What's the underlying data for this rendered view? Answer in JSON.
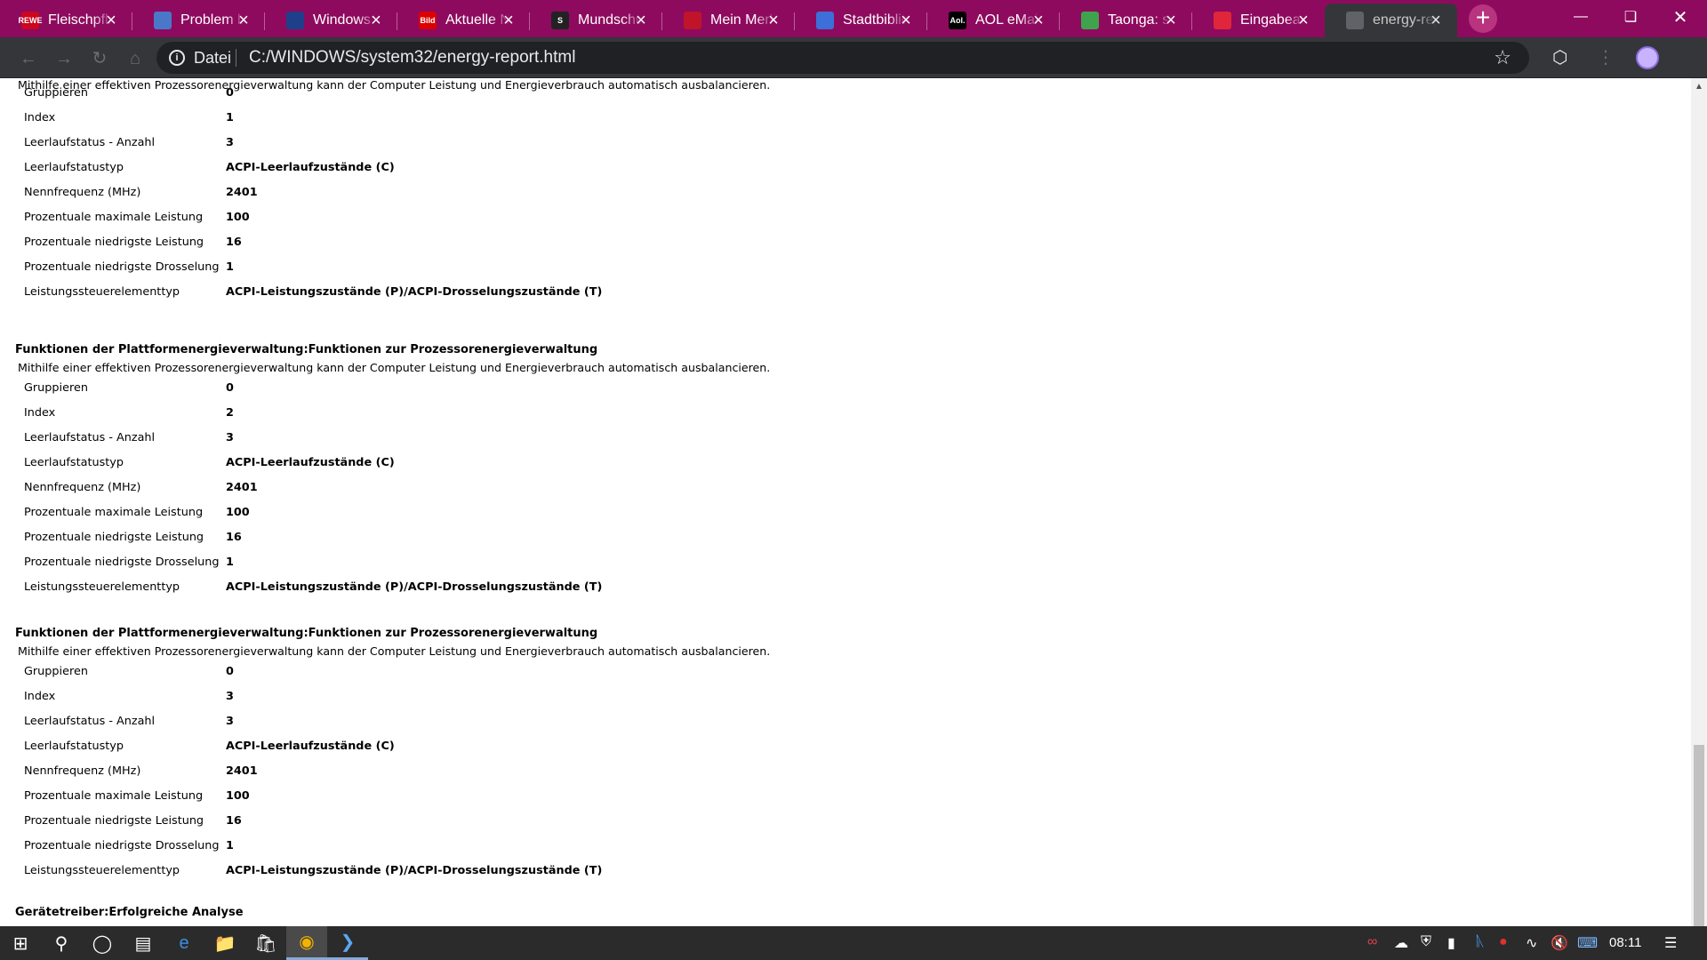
{
  "browser": {
    "tabs": [
      {
        "title": "Fleischpfla",
        "favicon": "rewe-icon",
        "fav_color": "#cc071e",
        "fav_text": "REWE"
      },
      {
        "title": "Problem b",
        "favicon": "globe-icon",
        "fav_color": "#4a78c8",
        "fav_text": ""
      },
      {
        "title": "Windows:",
        "favicon": "windows-central-icon",
        "fav_color": "#1f3f8a",
        "fav_text": ""
      },
      {
        "title": "Aktuelle N",
        "favicon": "bild-icon",
        "fav_color": "#dd0000",
        "fav_text": "Bild"
      },
      {
        "title": "Mundschu",
        "favicon": "s-logo-icon",
        "fav_color": "#222222",
        "fav_text": "S"
      },
      {
        "title": "Mein Merk",
        "favicon": "merkur-icon",
        "fav_color": "#c0142a",
        "fav_text": ""
      },
      {
        "title": "Stadtbiblio",
        "favicon": "library-icon",
        "fav_color": "#3c6fd8",
        "fav_text": ""
      },
      {
        "title": "AOL eMail",
        "favicon": "aol-icon",
        "fav_color": "#000000",
        "fav_text": "Aol."
      },
      {
        "title": "Taonga: st",
        "favicon": "taonga-icon",
        "fav_color": "#3fa34d",
        "fav_text": ""
      },
      {
        "title": "Eingabeau",
        "favicon": "input-icon",
        "fav_color": "#e0263a",
        "fav_text": ""
      },
      {
        "title": "energy-rep",
        "favicon": "page-icon",
        "fav_color": "#5f6368",
        "fav_text": ""
      }
    ],
    "active_tab_index": 10,
    "scheme_label": "Datei",
    "url": "C:/WINDOWS/system32/energy-report.html"
  },
  "report": {
    "top_description": "Mithilfe einer effektiven Prozessorenergieverwaltung kann der Computer Leistung und Energieverbrauch automatisch ausbalancieren.",
    "sections": [
      {
        "title": "",
        "description": "",
        "rows": [
          {
            "label": "Gruppieren",
            "value": "0"
          },
          {
            "label": "Index",
            "value": "1"
          },
          {
            "label": "Leerlaufstatus - Anzahl",
            "value": "3"
          },
          {
            "label": "Leerlaufstatustyp",
            "value": "ACPI-Leerlaufzustände (C)"
          },
          {
            "label": "Nennfrequenz (MHz)",
            "value": "2401"
          },
          {
            "label": "Prozentuale maximale Leistung",
            "value": "100"
          },
          {
            "label": "Prozentuale niedrigste Leistung",
            "value": "16"
          },
          {
            "label": "Prozentuale niedrigste Drosselung",
            "value": "1"
          },
          {
            "label": "Leistungssteuerelementtyp",
            "value": "ACPI-Leistungszustände (P)/ACPI-Drosselungszustände (T)"
          }
        ]
      },
      {
        "title": "Funktionen der Plattformenergieverwaltung:Funktionen zur Prozessorenergieverwaltung",
        "description": "Mithilfe einer effektiven Prozessorenergieverwaltung kann der Computer Leistung und Energieverbrauch automatisch ausbalancieren.",
        "rows": [
          {
            "label": "Gruppieren",
            "value": "0"
          },
          {
            "label": "Index",
            "value": "2"
          },
          {
            "label": "Leerlaufstatus - Anzahl",
            "value": "3"
          },
          {
            "label": "Leerlaufstatustyp",
            "value": "ACPI-Leerlaufzustände (C)"
          },
          {
            "label": "Nennfrequenz (MHz)",
            "value": "2401"
          },
          {
            "label": "Prozentuale maximale Leistung",
            "value": "100"
          },
          {
            "label": "Prozentuale niedrigste Leistung",
            "value": "16"
          },
          {
            "label": "Prozentuale niedrigste Drosselung",
            "value": "1"
          },
          {
            "label": "Leistungssteuerelementtyp",
            "value": "ACPI-Leistungszustände (P)/ACPI-Drosselungszustände (T)"
          }
        ]
      },
      {
        "title": "Funktionen der Plattformenergieverwaltung:Funktionen zur Prozessorenergieverwaltung",
        "description": "Mithilfe einer effektiven Prozessorenergieverwaltung kann der Computer Leistung und Energieverbrauch automatisch ausbalancieren.",
        "rows": [
          {
            "label": "Gruppieren",
            "value": "0"
          },
          {
            "label": "Index",
            "value": "3"
          },
          {
            "label": "Leerlaufstatus - Anzahl",
            "value": "3"
          },
          {
            "label": "Leerlaufstatustyp",
            "value": "ACPI-Leerlaufzustände (C)"
          },
          {
            "label": "Nennfrequenz (MHz)",
            "value": "2401"
          },
          {
            "label": "Prozentuale maximale Leistung",
            "value": "100"
          },
          {
            "label": "Prozentuale niedrigste Leistung",
            "value": "16"
          },
          {
            "label": "Prozentuale niedrigste Drosselung",
            "value": "1"
          },
          {
            "label": "Leistungssteuerelementtyp",
            "value": "ACPI-Leistungszustände (P)/ACPI-Drosselungszustände (T)"
          }
        ]
      }
    ],
    "next_section_title": "Gerätetreiber:Erfolgreiche Analyse"
  },
  "taskbar": {
    "clock": "08:11"
  },
  "colors": {
    "tabstrip": "#8e0a5e",
    "toolbar": "#35363a",
    "omnibox": "#202124",
    "taskbar": "#2b2b2b"
  }
}
